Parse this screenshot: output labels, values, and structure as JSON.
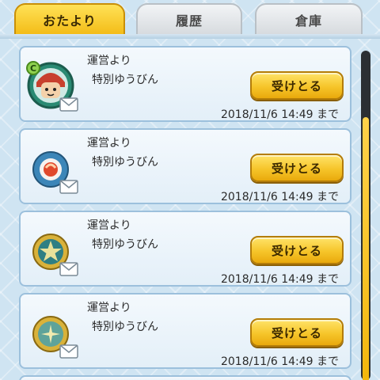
{
  "tabs": [
    {
      "label": "おたより",
      "active": true
    },
    {
      "label": "履歴",
      "active": false
    },
    {
      "label": "倉庫",
      "active": false
    }
  ],
  "messages": [
    {
      "sender": "運営より",
      "subject": "特別ゆうびん",
      "button_label": "受けとる",
      "deadline": "2018/11/6 14:49 まで",
      "icon": "character-portrait-icon"
    },
    {
      "sender": "運営より",
      "subject": "特別ゆうびん",
      "button_label": "受けとる",
      "deadline": "2018/11/6 14:49 まで",
      "icon": "red-orb-medal-icon"
    },
    {
      "sender": "運営より",
      "subject": "特別ゆうびん",
      "button_label": "受けとる",
      "deadline": "2018/11/6 14:49 まで",
      "icon": "gold-star-medal-icon"
    },
    {
      "sender": "運営より",
      "subject": "特別ゆうびん",
      "button_label": "受けとる",
      "deadline": "2018/11/6 14:49 まで",
      "icon": "gold-star-medal-icon"
    }
  ],
  "colors": {
    "accent": "#f6c52a",
    "background": "#cfe4f2",
    "card": "#eaf3fa"
  }
}
